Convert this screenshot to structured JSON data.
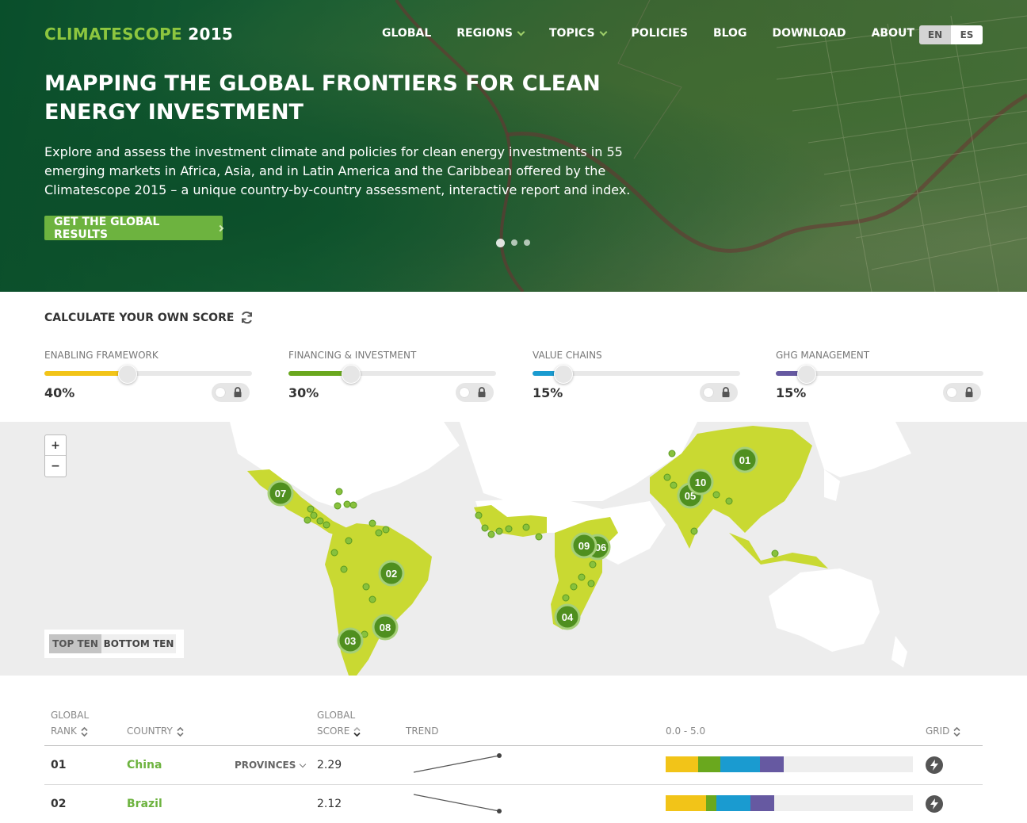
{
  "header": {
    "logo_brand": "CLIMATESCOPE",
    "logo_year": "2015",
    "nav": [
      {
        "label": "GLOBAL"
      },
      {
        "label": "REGIONS"
      },
      {
        "label": "TOPICS"
      },
      {
        "label": "POLICIES"
      },
      {
        "label": "BLOG"
      },
      {
        "label": "DOWNLOAD"
      },
      {
        "label": "ABOUT"
      }
    ],
    "lang": {
      "en": "EN",
      "es": "ES",
      "selected": "EN"
    }
  },
  "hero": {
    "title": "MAPPING THE GLOBAL FRONTIERS FOR CLEAN ENERGY INVESTMENT",
    "description": "Explore and assess the investment climate and policies for clean energy investments in 55 emerging markets in Africa, Asia, and in Latin America and the Caribbean offered by the Climatescope 2015 – a unique country-by-country assessment, interactive report and index.",
    "cta": "GET THE GLOBAL RESULTS",
    "slides_total": 3,
    "slide_active": 1
  },
  "calculator": {
    "title": "CALCULATE YOUR OWN SCORE",
    "sliders": [
      {
        "label": "ENABLING FRAMEWORK",
        "value": "40%",
        "fraction": 0.4,
        "color": "#f2c418"
      },
      {
        "label": "FINANCING & INVESTMENT",
        "value": "30%",
        "fraction": 0.3,
        "color": "#6aa81e"
      },
      {
        "label": "VALUE CHAINS",
        "value": "15%",
        "fraction": 0.15,
        "color": "#1a9bd0"
      },
      {
        "label": "GHG MANAGEMENT",
        "value": "15%",
        "fraction": 0.15,
        "color": "#6659a1"
      }
    ]
  },
  "map": {
    "zoom_in": "+",
    "zoom_out": "−",
    "toggle": {
      "top": "TOP TEN",
      "bottom": "BOTTOM TEN",
      "selected": "TOP TEN"
    },
    "markers": [
      "01",
      "02",
      "03",
      "04",
      "05",
      "06",
      "07",
      "08",
      "09",
      "10"
    ]
  },
  "table": {
    "headers": {
      "rank_line1": "GLOBAL",
      "rank_line2": "RANK",
      "country": "COUNTRY",
      "score_line1": "GLOBAL",
      "score_line2": "SCORE",
      "trend": "TREND",
      "range": "0.0 - 5.0",
      "grid": "GRID"
    },
    "rows": [
      {
        "rank": "01",
        "country": "China",
        "provinces": "PROVINCES",
        "score": "2.29",
        "segments": [
          0.66,
          0.44,
          0.81,
          0.48
        ]
      },
      {
        "rank": "02",
        "country": "Brazil",
        "score": "2.12",
        "segments": [
          0.81,
          0.22,
          0.69,
          0.48
        ]
      }
    ]
  }
}
